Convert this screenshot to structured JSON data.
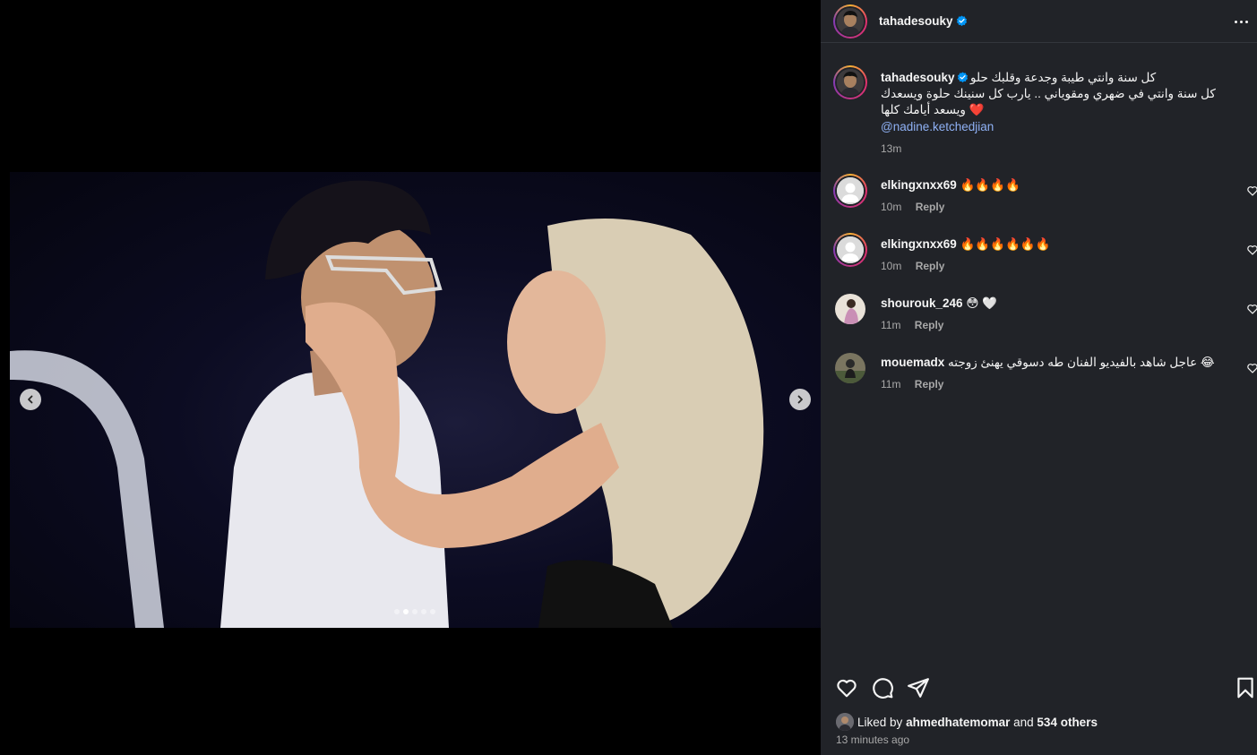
{
  "post": {
    "author": "tahadesouky",
    "verified": true,
    "carousel": {
      "total_slides": 5,
      "active_slide": 2
    }
  },
  "caption": {
    "username": "tahadesouky",
    "line1": "كل سنة وانتي طيبة وجدعة وقلبك حلو",
    "line2": "كل سنة وانتي في ضهري ومقوياني .. يارب كل سنينك حلوة ويسعدك",
    "line3": "ويسعد أيامك كلها",
    "emoji": "❤️",
    "mention": "@nadine.ketchedjian",
    "time": "13m"
  },
  "comments": [
    {
      "username": "elkingxnxx69",
      "text": "🔥🔥🔥🔥",
      "time": "10m",
      "reply_label": "Reply",
      "story_ring": true
    },
    {
      "username": "elkingxnxx69",
      "text": "🔥🔥🔥🔥🔥🔥",
      "time": "10m",
      "reply_label": "Reply",
      "story_ring": true
    },
    {
      "username": "shourouk_246",
      "text": "😳 🤍",
      "time": "11m",
      "reply_label": "Reply",
      "story_ring": false
    },
    {
      "username": "mouemadx",
      "text": "😂 عاجل شاهد بالفيديو الفنان طه دسوقي يهنئ زوجته",
      "time": "11m",
      "reply_label": "Reply",
      "story_ring": false
    }
  ],
  "likes": {
    "prefix": "Liked by",
    "liker": "ahmedhatemomar",
    "and": "and",
    "others": "534 others"
  },
  "posted_ago": "13 minutes ago",
  "colors": {
    "panel_bg": "#212328",
    "link_blue": "#8fb1f5",
    "verified_blue": "#0095f6",
    "muted_text": "#a8a8a8",
    "heart_red": "#ff3040"
  },
  "icons": [
    "more-options-icon",
    "verified-badge-icon",
    "chevron-left-icon",
    "chevron-right-icon",
    "heart-icon",
    "comment-icon",
    "share-icon",
    "bookmark-icon"
  ]
}
